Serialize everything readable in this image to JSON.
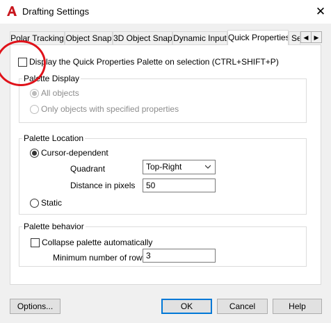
{
  "window": {
    "title": "Drafting Settings",
    "app_icon": "autocad-a-icon",
    "close_glyph": "✕"
  },
  "tabs": [
    {
      "label": "Polar Tracking"
    },
    {
      "label": "Object Snap"
    },
    {
      "label": "3D Object Snap"
    },
    {
      "label": "Dynamic Input"
    },
    {
      "label": "Quick Properties"
    },
    {
      "label": "Se"
    }
  ],
  "active_tab": "Quick Properties",
  "tab_scroll": {
    "left": "◀",
    "right": "▶"
  },
  "display_checkbox": {
    "label": "Display the Quick Properties Palette on selection (CTRL+SHIFT+P)",
    "checked": false
  },
  "palette_display": {
    "title": "Palette Display",
    "options": [
      {
        "label": "All objects",
        "selected": true,
        "enabled": false
      },
      {
        "label": "Only objects with specified properties",
        "selected": false,
        "enabled": false
      }
    ]
  },
  "palette_location": {
    "title": "Palette Location",
    "cursor_dependent": {
      "label": "Cursor-dependent",
      "selected": true
    },
    "quadrant": {
      "label": "Quadrant",
      "value": "Top-Right"
    },
    "distance": {
      "label": "Distance in pixels",
      "value": "50"
    },
    "static": {
      "label": "Static",
      "selected": false
    }
  },
  "palette_behavior": {
    "title": "Palette behavior",
    "collapse": {
      "label": "Collapse palette automatically",
      "checked": false
    },
    "min_rows": {
      "label": "Minimum number of rows",
      "value": "3"
    }
  },
  "buttons": {
    "options": "Options...",
    "ok": "OK",
    "cancel": "Cancel",
    "help": "Help"
  },
  "colors": {
    "accent": "#0078d7",
    "annotation": "#e0121a",
    "app_icon_red": "#c8161d"
  }
}
